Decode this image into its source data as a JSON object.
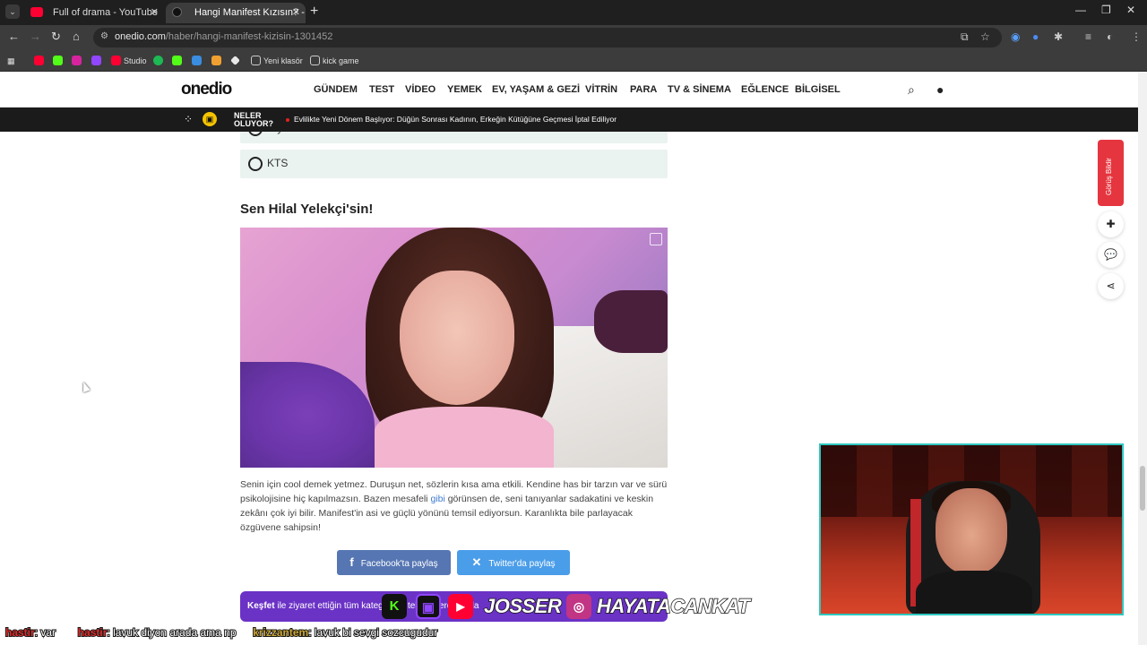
{
  "browser": {
    "tabs": [
      {
        "title": "Full of drama - YouTube",
        "active": false
      },
      {
        "title": "Hangi Manifest Kızısın? - Onedio",
        "active": true
      }
    ],
    "url_host": "onedio.com",
    "url_path": "/haber/hangi-manifest-kizisin-1301452",
    "bookmarks": [
      "Studio",
      "Yeni klasör",
      "kick game"
    ]
  },
  "site": {
    "logo": "onedio",
    "nav": [
      "GÜNDEM",
      "TEST",
      "VİDEO",
      "YEMEK",
      "EV, YAŞAM & GEZİ",
      "VİTRİN",
      "PARA",
      "TV & SİNEMA",
      "EĞLENCE",
      "BİLGİSEL"
    ],
    "ticker_brand_line1": "NELER",
    "ticker_brand_line2": "OLUYOR?",
    "ticker_headline": "Evlilikte Yeni Dönem Başlıyor: Düğün Sonrası Kadının, Erkeğin Kütüğüne Geçmesi İptal Ediliyor"
  },
  "quiz": {
    "options": [
      {
        "label": "Hiyo"
      },
      {
        "label": "KTS"
      }
    ],
    "result_title": "Sen Hilal Yelekçi'sin!",
    "description_part1": "Senin için cool demek yetmez. Duruşun net, sözlerin kısa ama etkili. Kendine has bir tarzın var ve sürü psikolojisine hiç kapılmazsın. Bazen mesafeli ",
    "description_link": "gibi",
    "description_part2": " görünsen de, seni tanıyanlar sadakatini ve keskin zekânı çok iyi bilir. Manifest'in asi ve güçlü yönünü temsil ediyorsun. Karanlıkta bile parlayacak özgüvene sahipsin!",
    "share_facebook": "Facebook'ta paylaş",
    "share_twitter": "Twitter'da paylaş",
    "kesfet_bold": "Keşfet",
    "kesfet_text": " ile ziyaret ettiğin tüm kategorileri tek bir yerde topla"
  },
  "sidebar": {
    "feedback_label": "Görüş Bildir"
  },
  "stream": {
    "overlay_handle1": "JOSSER",
    "overlay_handle2": "HAYATACANKAT",
    "chat": [
      {
        "user": "hastir",
        "message": ": var"
      },
      {
        "user": "hastir",
        "message": ": lavuk diyon arada ama np"
      },
      {
        "user": "krizzantem",
        "message": ": lavuk bi sevgi sozcugudur"
      }
    ]
  },
  "colors": {
    "accent_purple": "#6b32c6",
    "facebook": "#5676b3",
    "twitter": "#4a9de9",
    "feedback_red": "#e5353f",
    "cam_border": "#2fc8c0"
  }
}
